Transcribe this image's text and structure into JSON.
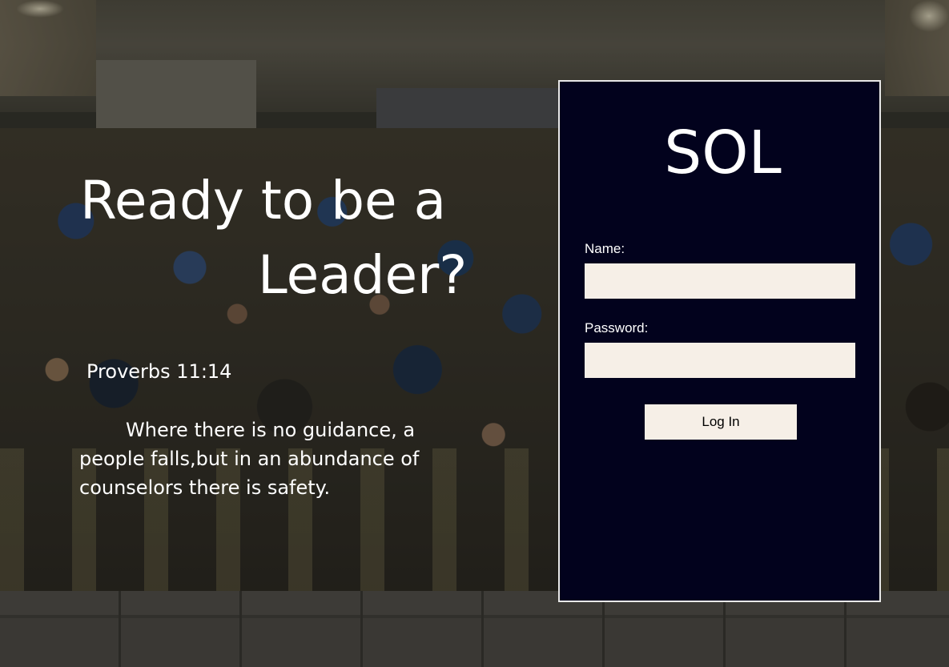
{
  "hero": {
    "headline_line1": "Ready to be a",
    "headline_line2": "Leader?",
    "verse_reference": "Proverbs 11:14",
    "verse_text": "Where there is no guidance, a people falls,but in an abundance of counselors there is safety."
  },
  "login": {
    "brand": "SOL",
    "name_label": "Name:",
    "name_value": "",
    "password_label": "Password:",
    "password_value": "",
    "submit_label": "Log In"
  },
  "colors": {
    "panel_background": "#02021d",
    "input_background": "#f6efe7",
    "text_light": "#ffffff"
  }
}
